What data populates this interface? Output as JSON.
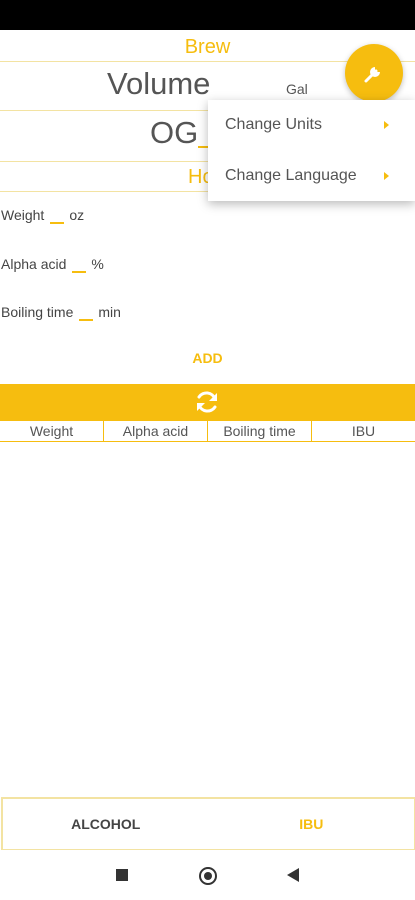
{
  "header": {
    "title": "Brew"
  },
  "volume": {
    "label": "Volume",
    "unit": "Gal"
  },
  "og": {
    "label": "OG"
  },
  "hops": {
    "title": "Ho"
  },
  "fields": [
    {
      "label": "Weight",
      "unit": "oz"
    },
    {
      "label": "Alpha acid",
      "unit": "%"
    },
    {
      "label": "Boiling time",
      "unit": "min"
    }
  ],
  "add_button": {
    "label": "ADD"
  },
  "table": {
    "columns": [
      "Weight",
      "Alpha acid",
      "Boiling time",
      "IBU"
    ]
  },
  "tabs": {
    "alcohol": "ALCOHOL",
    "ibu": "IBU"
  },
  "menu": {
    "items": [
      "Change Units",
      "Change Language"
    ]
  },
  "icons": {
    "fab": "wrench-icon",
    "refresh": "refresh-icon"
  },
  "colors": {
    "accent": "#f6bd0f",
    "text": "#555555"
  }
}
